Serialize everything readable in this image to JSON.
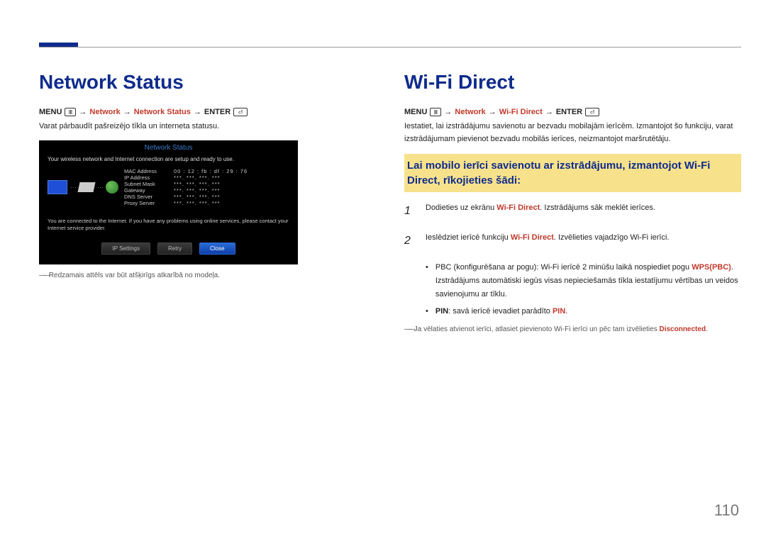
{
  "page_number": "110",
  "left": {
    "heading": "Network Status",
    "menu": {
      "menu_label": "MENU",
      "path1": "Network",
      "path2": "Network Status",
      "enter_label": "ENTER"
    },
    "description": "Varat pārbaudīt pašreizējo tīkla un interneta statusu.",
    "footnote": "Redzamais attēls var būt atšķirīgs atkarībā no modeļa.",
    "shot": {
      "title": "Network Status",
      "line1": "Your wireless network and Internet connection are setup and ready to use.",
      "rows": [
        {
          "label": "MAC Address",
          "value": "00 : 12 : fb : df : 29 : 76"
        },
        {
          "label": "IP Address",
          "value": "***. ***. ***. ***"
        },
        {
          "label": "Subnet Mask",
          "value": "***. ***. ***. ***"
        },
        {
          "label": "Gateway",
          "value": "***. ***. ***. ***"
        },
        {
          "label": "DNS Server",
          "value": "***. ***. ***. ***"
        },
        {
          "label": "Proxy Server",
          "value": "***. ***. ***. ***"
        }
      ],
      "msg": "You are connected to the Internet. If you have any problems using online services, please contact your Internet service provider.",
      "btn_ip": "IP Settings",
      "btn_retry": "Retry",
      "btn_close": "Close"
    }
  },
  "right": {
    "heading": "Wi-Fi Direct",
    "menu": {
      "menu_label": "MENU",
      "path1": "Network",
      "path2": "Wi-Fi Direct",
      "enter_label": "ENTER"
    },
    "description": "Iestatiet, lai izstrādājumu savienotu ar bezvadu mobilajām ierīcēm. Izmantojot šo funkciju, varat izstrādājumam pievienot bezvadu mobilās ierīces, neizmantojot maršrutētāju.",
    "highlight": "Lai mobilo ierīci savienotu ar izstrādājumu, izmantojot Wi-Fi Direct, rīkojieties šādi:",
    "steps": {
      "s1_num": "1",
      "s1_a": "Dodieties uz ekrānu ",
      "s1_hl": "Wi-Fi Direct",
      "s1_b": ". Izstrādājums sāk meklēt ierīces.",
      "s2_num": "2",
      "s2_a": "Ieslēdziet ierīcē funkciju ",
      "s2_hl": "Wi-Fi Direct",
      "s2_b": ". Izvēlieties vajadzīgo Wi-Fi ierīci."
    },
    "bullets": {
      "b1_a": "PBC (konfigurēšana ar pogu): Wi-Fi ierīcē 2 minūšu laikā nospiediet pogu ",
      "b1_hl": "WPS(PBC)",
      "b1_b": ". Izstrādājums automātiski iegūs visas nepieciešamās tīkla iestatījumu vērtības un veidos savienojumu ar tīklu.",
      "b2_a": "PIN",
      "b2_b": ": savā ierīcē ievadiet parādīto ",
      "b2_hl": "PIN",
      "b2_c": "."
    },
    "footnote_a": "Ja vēlaties atvienot ierīci, atlasiet pievienoto Wi-Fi ierīci un pēc tam izvēlieties ",
    "footnote_hl": "Disconnected",
    "footnote_b": "."
  }
}
